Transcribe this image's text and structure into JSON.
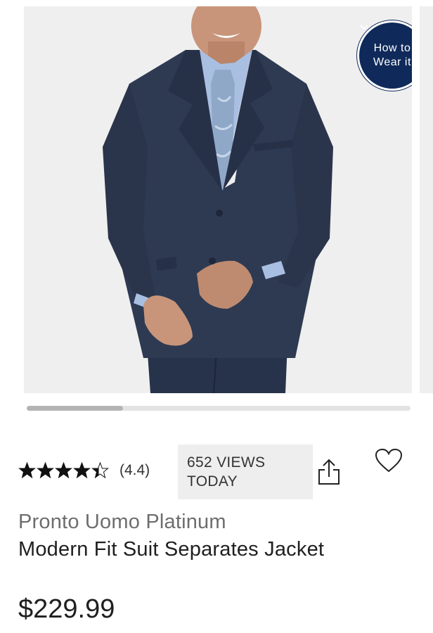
{
  "carousel": {
    "how_to_wear": {
      "line1": "How to",
      "line2": "Wear it"
    },
    "scroll_position": 0.25
  },
  "rating": {
    "stars": 4.4,
    "label": "(4.4)"
  },
  "views": {
    "line1": "652 VIEWS",
    "line2": "TODAY"
  },
  "product": {
    "brand": "Pronto Uomo Platinum",
    "name": "Modern Fit Suit Separates Jacket",
    "price": "$229.99"
  },
  "colors": {
    "navy_badge": "#0f2a5a",
    "image_bg": "#efefef"
  }
}
